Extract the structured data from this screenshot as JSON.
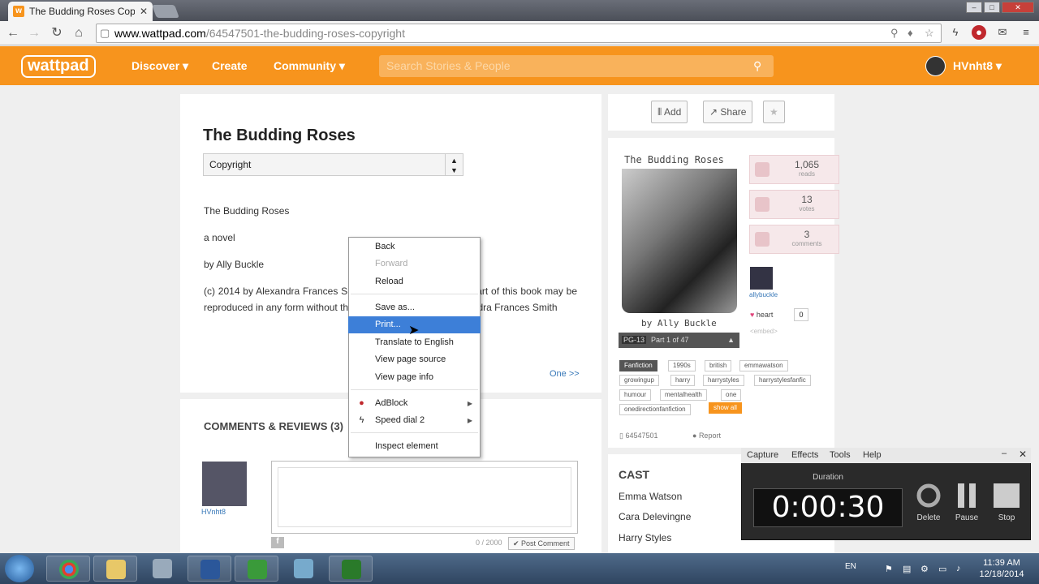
{
  "browser": {
    "tab_title": "The Budding Roses Copyr",
    "tab_close": "✕",
    "url_host": "www.wattpad.com",
    "url_path": "/64547501-the-budding-roses-copyright"
  },
  "site": {
    "logo": "wattpad",
    "nav": [
      "Discover ▾",
      "Create",
      "Community ▾"
    ],
    "search_placeholder": "Search Stories & People",
    "username": "HVnht8 ▾"
  },
  "story": {
    "title": "The Budding Roses",
    "part_select": "Copyright",
    "lines": [
      "The Budding Roses",
      "a novel",
      "by Ally Buckle"
    ],
    "paragraph": "(c) 2014 by Alexandra Frances Smith. All rights reserved. No part of this book may be reproduced in any form without the written permission of Alexandra Frances Smith",
    "next_part": "One >>"
  },
  "comments": {
    "heading": "COMMENTS & REVIEWS (3)",
    "user": "HVnht8",
    "char_count": "0 / 2000",
    "post_label": "✔ Post Comment"
  },
  "actions": {
    "add": "Add",
    "share": "Share",
    "star": "★"
  },
  "cover": {
    "title": "The Budding Roses",
    "author": "by Ally Buckle",
    "rating": "PG-13",
    "part": "Part 1 of 47"
  },
  "stats": [
    {
      "num": "1,065",
      "label": "reads"
    },
    {
      "num": "13",
      "label": "votes"
    },
    {
      "num": "3",
      "label": "comments"
    }
  ],
  "author": {
    "name": "allybuckle",
    "heart": "heart",
    "heart_count": "0",
    "embed": "<embed>"
  },
  "tags": [
    "Fanfiction",
    "1990s",
    "british",
    "emmawatson",
    "growingup",
    "harry",
    "harrystyles",
    "harrystylesfanfic",
    "humour",
    "mentalhealth",
    "one",
    "onedirectionfanfiction",
    "show all"
  ],
  "meta": {
    "story_id": "64547501",
    "report": "Report"
  },
  "cast": {
    "heading": "CAST",
    "names": [
      "Emma Watson",
      "Cara Delevingne",
      "Harry Styles"
    ]
  },
  "context_menu": {
    "items": [
      "Back",
      "Forward",
      "Reload",
      "Save as...",
      "Print...",
      "Translate to English",
      "View page source",
      "View page info",
      "AdBlock",
      "Speed dial 2",
      "Inspect element"
    ]
  },
  "recorder": {
    "menu": [
      "Capture",
      "Effects",
      "Tools",
      "Help"
    ],
    "duration_label": "Duration",
    "time": "0:00:30",
    "buttons": [
      "Delete",
      "Pause",
      "Stop"
    ]
  },
  "taskbar": {
    "lang": "EN",
    "time": "11:39 AM",
    "date": "12/18/2014"
  },
  "colors": {
    "brand": "#f7941d",
    "link": "#3878b8",
    "selected": "#3d7fd8"
  }
}
